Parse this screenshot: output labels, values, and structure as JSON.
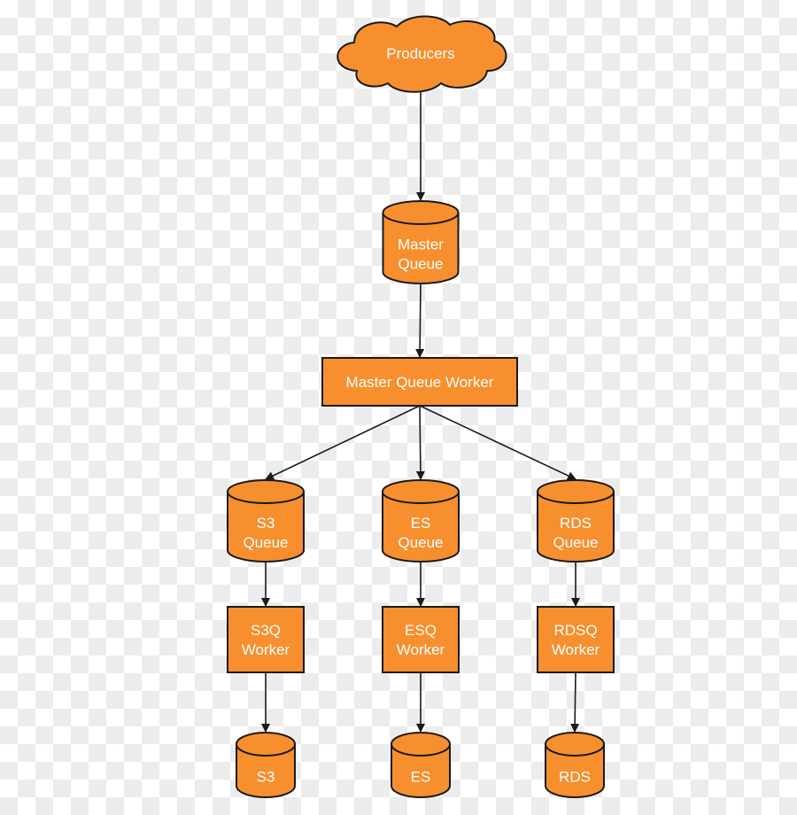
{
  "colors": {
    "node_fill": "#f78f2e",
    "stroke": "#1a1a1a",
    "text": "#ffffff"
  },
  "nodes": {
    "producers": {
      "lines": [
        "Producers"
      ],
      "shape": "cloud"
    },
    "master_queue": {
      "lines": [
        "Master",
        "Queue"
      ],
      "shape": "cylinder"
    },
    "master_queue_worker": {
      "lines": [
        "Master Queue Worker"
      ],
      "shape": "rectangle"
    },
    "s3_queue": {
      "lines": [
        "S3",
        "Queue"
      ],
      "shape": "cylinder"
    },
    "es_queue": {
      "lines": [
        "ES",
        "Queue"
      ],
      "shape": "cylinder"
    },
    "rds_queue": {
      "lines": [
        "RDS",
        "Queue"
      ],
      "shape": "cylinder"
    },
    "s3q_worker": {
      "lines": [
        "S3Q",
        "Worker"
      ],
      "shape": "rectangle"
    },
    "esq_worker": {
      "lines": [
        "ESQ",
        "Worker"
      ],
      "shape": "rectangle"
    },
    "rdsq_worker": {
      "lines": [
        "RDSQ",
        "Worker"
      ],
      "shape": "rectangle"
    },
    "s3": {
      "lines": [
        "S3"
      ],
      "shape": "cylinder"
    },
    "es": {
      "lines": [
        "ES"
      ],
      "shape": "cylinder"
    },
    "rds": {
      "lines": [
        "RDS"
      ],
      "shape": "cylinder"
    }
  },
  "edges": [
    [
      "producers",
      "master_queue"
    ],
    [
      "master_queue",
      "master_queue_worker"
    ],
    [
      "master_queue_worker",
      "s3_queue"
    ],
    [
      "master_queue_worker",
      "es_queue"
    ],
    [
      "master_queue_worker",
      "rds_queue"
    ],
    [
      "s3_queue",
      "s3q_worker"
    ],
    [
      "es_queue",
      "esq_worker"
    ],
    [
      "rds_queue",
      "rdsq_worker"
    ],
    [
      "s3q_worker",
      "s3"
    ],
    [
      "esq_worker",
      "es"
    ],
    [
      "rdsq_worker",
      "rds"
    ]
  ]
}
